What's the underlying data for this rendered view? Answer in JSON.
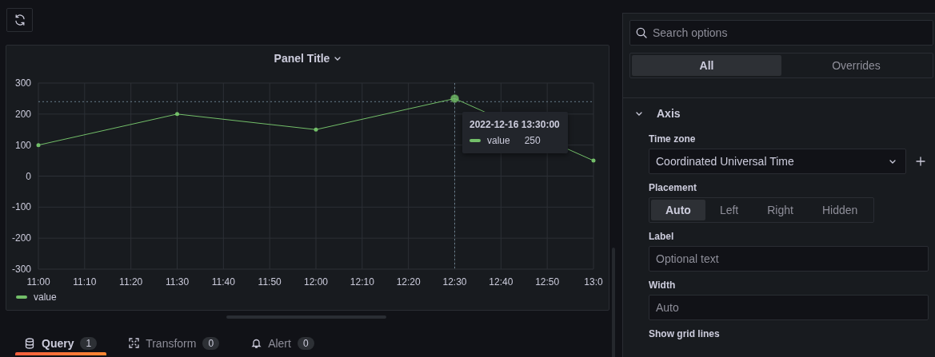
{
  "panel": {
    "title": "Panel Title",
    "chart_data": {
      "type": "line",
      "categories": [
        "11:00",
        "11:10",
        "11:20",
        "11:30",
        "11:40",
        "11:50",
        "12:00",
        "12:10",
        "12:20",
        "12:30",
        "12:40",
        "12:50",
        "13:0"
      ],
      "series": [
        {
          "name": "value",
          "color": "#73bf69",
          "values": [
            100,
            null,
            null,
            200,
            null,
            null,
            150,
            null,
            null,
            250,
            null,
            null,
            50
          ]
        }
      ],
      "ylim": [
        -300,
        300
      ],
      "yticks": [
        300,
        200,
        100,
        0,
        -100,
        -200,
        -300
      ],
      "grid": true,
      "ref_lines": [
        {
          "axis": "y",
          "value": 240
        },
        {
          "axis": "x",
          "value": "12:30"
        }
      ]
    },
    "tooltip": {
      "time": "2022-12-16 13:30:00",
      "label": "value",
      "value": "250",
      "color": "#73bf69"
    },
    "legend": true
  },
  "editor_tabs": [
    {
      "kind": "query",
      "label": "Query",
      "count": "1",
      "selected": true
    },
    {
      "kind": "transform",
      "label": "Transform",
      "count": "0",
      "selected": false
    },
    {
      "kind": "alert",
      "label": "Alert",
      "count": "0",
      "selected": false
    }
  ],
  "options": {
    "search": {
      "placeholder": "Search options"
    },
    "view_tabs": [
      {
        "label": "All",
        "selected": true
      },
      {
        "label": "Overrides",
        "selected": false
      }
    ],
    "section": {
      "title": "Axis",
      "expanded": true,
      "fields": [
        {
          "kind": "select",
          "label": "Time zone",
          "value": "Coordinated Universal Time"
        },
        {
          "kind": "radio",
          "label": "Placement",
          "options": [
            {
              "label": "Auto",
              "selected": true
            },
            {
              "label": "Left",
              "selected": false
            },
            {
              "label": "Right",
              "selected": false
            },
            {
              "label": "Hidden",
              "selected": false
            }
          ]
        },
        {
          "kind": "input",
          "label": "Label",
          "placeholder": "Optional text"
        },
        {
          "kind": "input",
          "label": "Width",
          "placeholder": "Auto"
        },
        {
          "kind": "heading",
          "label": "Show grid lines"
        }
      ]
    }
  }
}
